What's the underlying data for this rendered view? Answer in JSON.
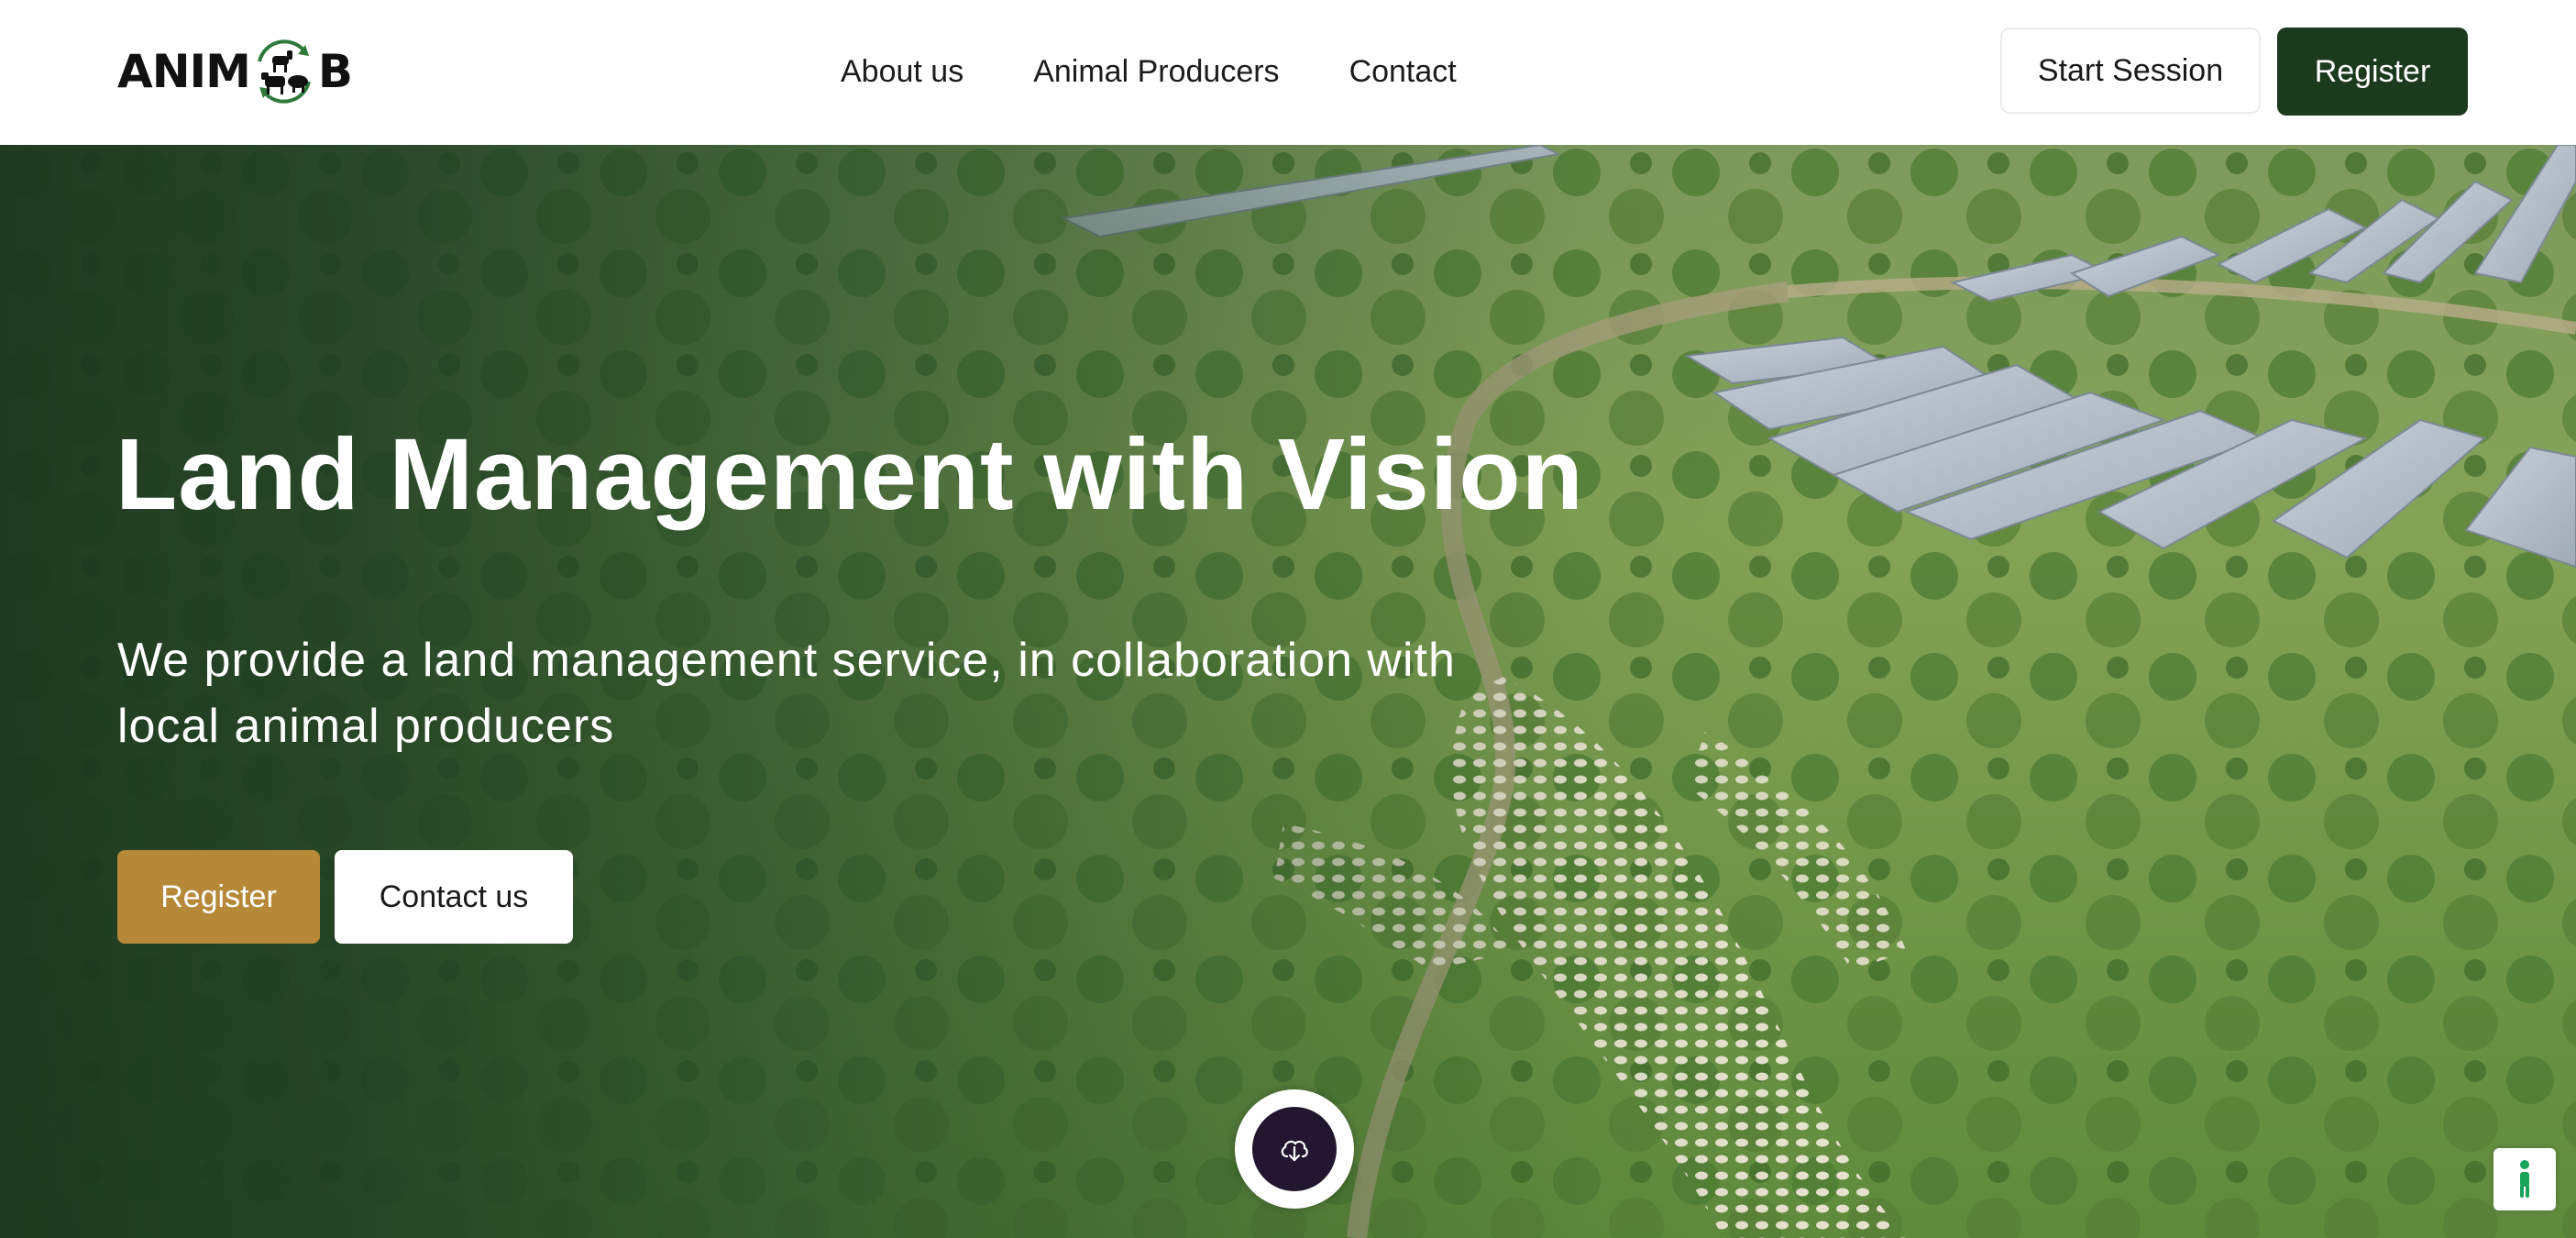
{
  "brand": {
    "logo_text_left": "ANIM",
    "logo_text_right": "B",
    "primary_color": "#1b3a1e",
    "accent_color": "#b58938"
  },
  "nav": {
    "items": [
      {
        "label": "About us"
      },
      {
        "label": "Animal Producers"
      },
      {
        "label": "Contact"
      }
    ]
  },
  "header_actions": {
    "start_session": "Start Session",
    "register": "Register"
  },
  "hero": {
    "title": "Land Management with Vision",
    "subtitle": "We provide a land management service, in collaboration with local animal producers",
    "register_button": "Register",
    "contact_button": "Contact us",
    "scroll_icon": "cloud-download-icon"
  },
  "widgets": {
    "accessibility_icon": "accessibility-icon"
  }
}
